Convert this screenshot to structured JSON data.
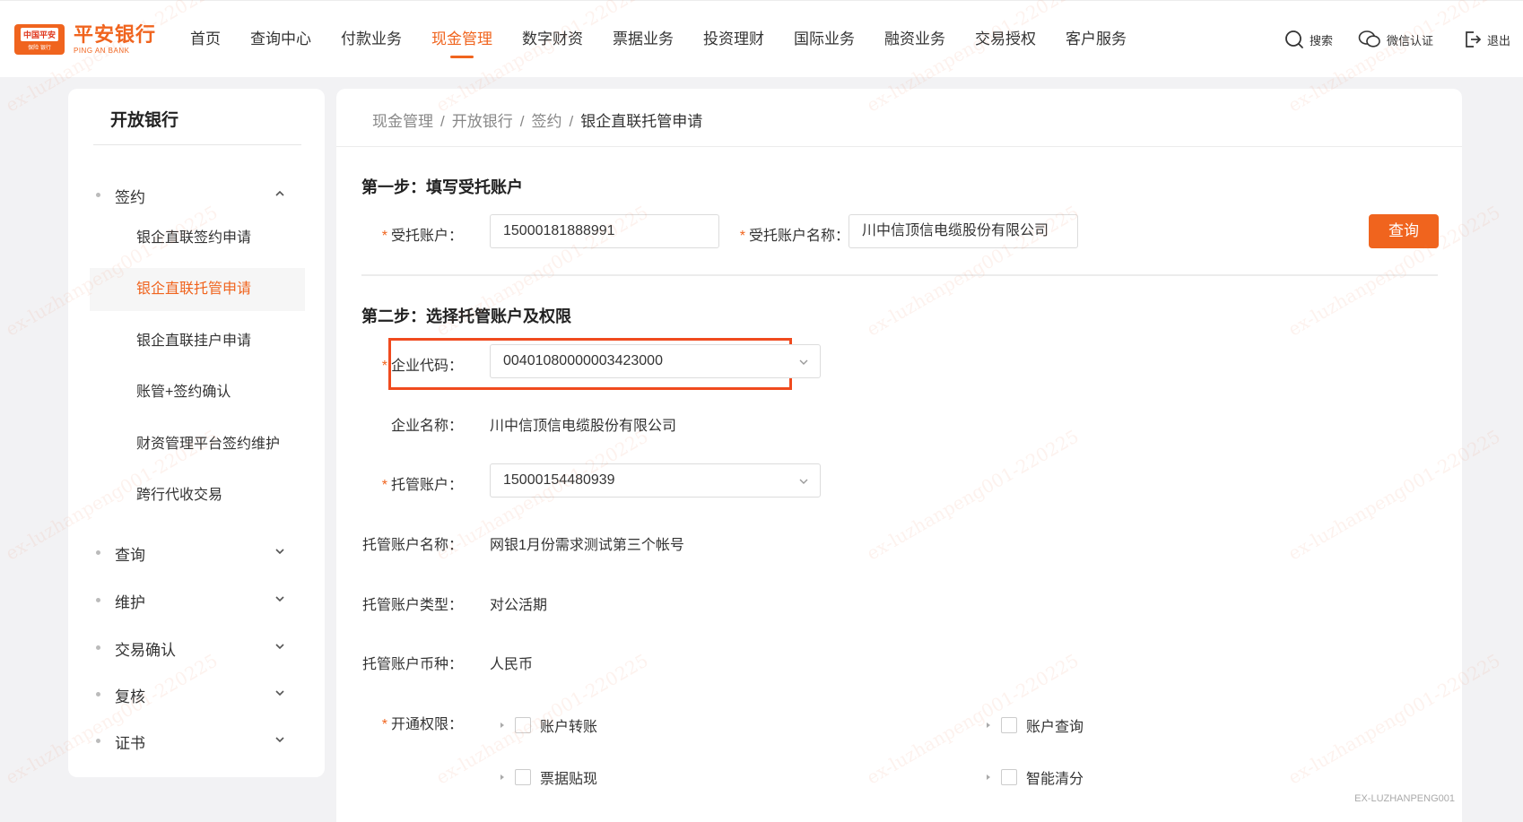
{
  "brand": {
    "box_top": "中国平安",
    "box_bottom": "保险 银行",
    "name_cn": "平安银行",
    "name_en": "PING AN BANK"
  },
  "nav": [
    {
      "label": "首页"
    },
    {
      "label": "查询中心"
    },
    {
      "label": "付款业务"
    },
    {
      "label": "现金管理",
      "active": true
    },
    {
      "label": "数字财资"
    },
    {
      "label": "票据业务"
    },
    {
      "label": "投资理财"
    },
    {
      "label": "国际业务"
    },
    {
      "label": "融资业务"
    },
    {
      "label": "交易授权"
    },
    {
      "label": "客户服务"
    }
  ],
  "utils": {
    "search": "搜索",
    "wechat": "微信认证",
    "logout": "退出"
  },
  "sidebar": {
    "title": "开放银行",
    "groups": {
      "sign": "签约",
      "query": "查询",
      "maintain": "维护",
      "confirm": "交易确认",
      "review": "复核",
      "cert": "证书"
    },
    "sub_items": [
      {
        "label": "银企直联签约申请"
      },
      {
        "label": "银企直联托管申请",
        "active": true
      },
      {
        "label": "银企直联挂户申请"
      },
      {
        "label": "账管+签约确认"
      },
      {
        "label": "财资管理平台签约维护"
      },
      {
        "label": "跨行代收交易"
      }
    ]
  },
  "breadcrumb": [
    "现金管理",
    "开放银行",
    "签约",
    "银企直联托管申请"
  ],
  "breadcrumb_sep": "/",
  "step1": {
    "title": "第一步：填写受托账户",
    "account_label": "受托账户：",
    "account_value": "15000181888991",
    "name_label": "受托账户名称：",
    "name_value": "川中信顶信电缆股份有限公司",
    "query_button": "查询"
  },
  "step2": {
    "title": "第二步：选择托管账户及权限",
    "code_label": "企业代码：",
    "code_value": "00401080000003423000",
    "company_label": "企业名称：",
    "company_value": "川中信顶信电缆股份有限公司",
    "custody_label": "托管账户：",
    "custody_value": "15000154480939",
    "custody_name_label": "托管账户名称：",
    "custody_name_value": "网银1月份需求测试第三个帐号",
    "custody_type_label": "托管账户类型：",
    "custody_type_value": "对公活期",
    "custody_currency_label": "托管账户币种：",
    "custody_currency_value": "人民币",
    "perm_label": "开通权限：",
    "permissions": [
      {
        "label": "账户转账"
      },
      {
        "label": "账户查询"
      },
      {
        "label": "票据贴现"
      },
      {
        "label": "智能清分"
      }
    ]
  },
  "watermark": "ex-luzhanpeng001-220225",
  "footer_user": "EX-LUZHANPENG001",
  "colors": {
    "accent": "#f0641e",
    "highlight_border": "#f04a1e"
  }
}
